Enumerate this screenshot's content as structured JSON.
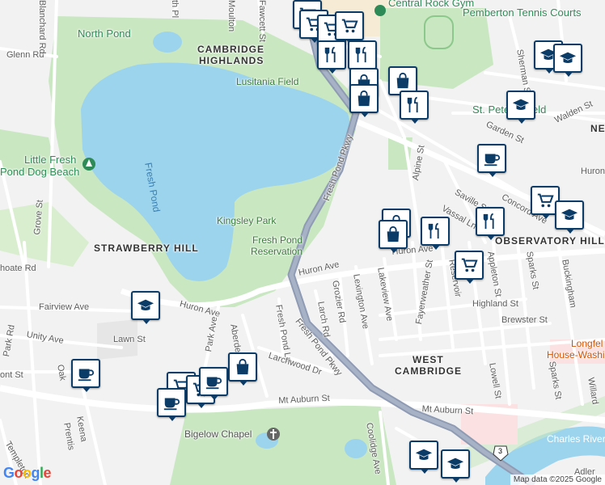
{
  "map": {
    "attribution": "Map data ©2025 Google",
    "logo": "Google"
  },
  "labels": {
    "north_pond": "North Pond",
    "cambridge_highlands_1": "CAMBRIDGE",
    "cambridge_highlands_2": "HIGHLANDS",
    "lusitania_field": "Lusitania Field",
    "fresh_pond": "Fresh Pond",
    "little_fresh_1": "Little Fresh",
    "little_fresh_2": "Pond Dog Beach",
    "kingsley_park": "Kingsley Park",
    "reservation_1": "Fresh Pond",
    "reservation_2": "Reservation",
    "strawberry_hill": "STRAWBERRY HILL",
    "observatory_hill": "OBSERVATORY HILL",
    "west_cambridge_1": "WEST",
    "west_cambridge_2": "CAMBRIDGE",
    "central_rock_gym": "Central Rock Gym",
    "pemberton_tennis": "Pemberton Tennis Courts",
    "st_peters_field": "St. Peter's Field",
    "longfellow_1": "Longfel",
    "longfellow_2": "House-Washingto",
    "bigelow_chapel": "Bigelow Chapel",
    "charles_river": "Charles River",
    "ne": "NE",
    "route_3": "3"
  },
  "streets": {
    "glenn": "Glenn Rd",
    "blanchard": "Blanchard Rd",
    "fawcett": "Fawcett St",
    "moulton": "Moulton",
    "smith": "th Pl",
    "fresh_pond_pkwy_n": "Fresh Pond Pkwy",
    "fresh_pond_pkwy_s": "Fresh Pond Pkwy",
    "grove": "Grove St",
    "choate": "hoate Rd",
    "fairview": "Fairview Ave",
    "unity": "Unity Ave",
    "lawn": "Lawn St",
    "huron_w": "Huron Ave",
    "huron_c": "Huron Ave",
    "huron_e": "Huron Ave",
    "huron_far": "Huron",
    "park_ave": "Park Ave",
    "aberdeen": "Aberdeen Ave",
    "fresh_pond_ln": "Fresh Pond Ln",
    "larchwood": "Larchwood Dr",
    "larch": "Larch Rd",
    "grozier": "Grozier Rd",
    "lexington": "Lexington Ave",
    "lakeview": "Lakeview Ave",
    "fayerweather": "Fayerweather St",
    "reservoir": "Reservoir",
    "appleton": "Appleton St",
    "sparks": "Sparks St",
    "sparks2": "Sparks St",
    "buckingham": "Buckingham",
    "highland": "Highland St",
    "brewster": "Brewster St",
    "lowell": "Lowell St",
    "willard": "Willard",
    "mt_auburn_w": "Mt Auburn St",
    "mt_auburn_e": "Mt Auburn St",
    "coolidge": "Coolidge Ave",
    "alpine": "Alpine St",
    "saville": "Saville St",
    "vassal": "Vassal Ln",
    "concord": "Concord Ave",
    "garden": "Garden St",
    "walden": "Walden St",
    "sherman": "Sherman St",
    "appleton2": "Appleton",
    "keena": "Keena",
    "prentiss": "Prentis",
    "templeton": "Templeton",
    "oak": "Oak",
    "park_rd": "Park Rd",
    "mont": "ont St",
    "dd": "d",
    "lakeview_short": "St",
    "adler": "Adler"
  },
  "poi_icons": [
    {
      "type": "grocery-icon"
    },
    {
      "type": "grocery-icon"
    },
    {
      "type": "grocery-icon"
    },
    {
      "type": "grocery-icon"
    },
    {
      "type": "restaurant-icon"
    },
    {
      "type": "restaurant-icon"
    },
    {
      "type": "shopping-bag-icon"
    },
    {
      "type": "shopping-bag-icon"
    },
    {
      "type": "shopping-bag-icon"
    },
    {
      "type": "restaurant-icon"
    },
    {
      "type": "school-icon"
    },
    {
      "type": "school-icon"
    },
    {
      "type": "school-icon"
    },
    {
      "type": "cafe-icon"
    },
    {
      "type": "grocery-icon"
    },
    {
      "type": "school-icon"
    },
    {
      "type": "restaurant-icon"
    },
    {
      "type": "shopping-bag-icon"
    },
    {
      "type": "shopping-bag-icon"
    },
    {
      "type": "grocery-icon"
    },
    {
      "type": "restaurant-icon"
    },
    {
      "type": "school-icon"
    },
    {
      "type": "cafe-icon"
    },
    {
      "type": "shopping-bag-icon"
    },
    {
      "type": "grocery-icon"
    },
    {
      "type": "grocery-icon"
    },
    {
      "type": "cafe-icon"
    },
    {
      "type": "cafe-icon"
    },
    {
      "type": "school-icon"
    },
    {
      "type": "school-icon"
    }
  ],
  "colors": {
    "water": "#9cd4ee",
    "park": "#c9e7c1",
    "road": "#ffffff",
    "highway": "#8f9bb3",
    "pin_border": "#0b3b67",
    "background": "#f2f2f2"
  }
}
